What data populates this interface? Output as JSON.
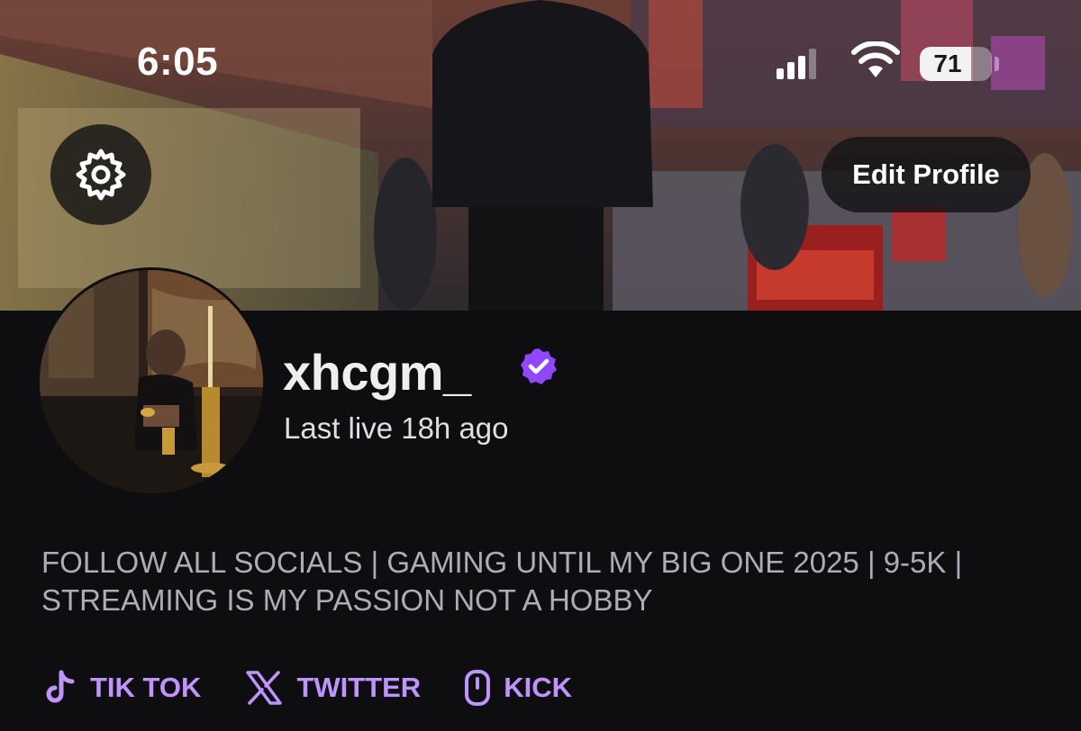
{
  "status_bar": {
    "time": "6:05",
    "battery_level": "71",
    "battery_fraction": 0.71,
    "signal_icon": "cellular-signal-icon",
    "wifi_icon": "wifi-icon"
  },
  "header": {
    "settings_icon": "gear-icon",
    "edit_profile_label": "Edit Profile"
  },
  "profile": {
    "username": "xhcgm_",
    "verified_icon": "verified-badge-icon",
    "status": "Last live 18h ago",
    "bio": "FOLLOW ALL SOCIALS | GAMING UNTIL MY BIG ONE 2025 | 9-5K | STREAMING IS MY PASSION NOT A HOBBY"
  },
  "socials": [
    {
      "label": "TIK TOK",
      "icon": "tiktok-icon"
    },
    {
      "label": "TWITTER",
      "icon": "x-icon"
    },
    {
      "label": "KICK",
      "icon": "kick-icon"
    }
  ],
  "colors": {
    "background": "#0e0e10",
    "accent": "#bf94ff",
    "verified": "#9147ff",
    "text_primary": "#efeff1",
    "text_secondary": "#adadb8"
  }
}
